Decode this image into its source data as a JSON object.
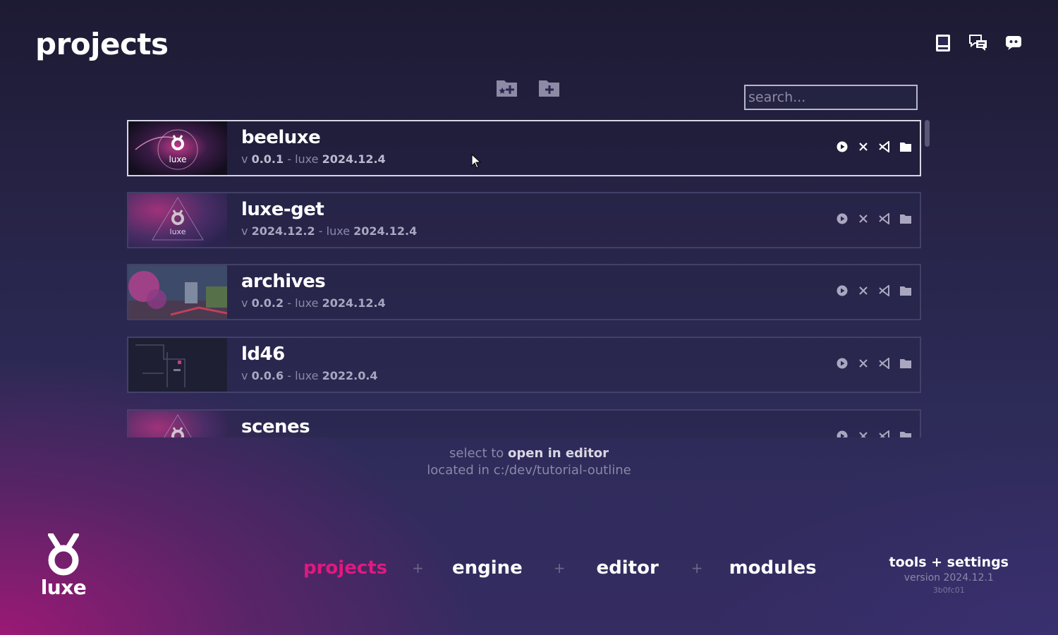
{
  "page": {
    "title": "projects"
  },
  "top_icons": [
    "book-icon",
    "chat-icon",
    "discord-icon"
  ],
  "tools": [
    "add-existing-folder-icon",
    "new-folder-icon"
  ],
  "search": {
    "placeholder": "search..."
  },
  "projects": [
    {
      "name": "beeluxe",
      "v_prefix": "v",
      "version": "0.0.1",
      "sep": "-",
      "engine_label": "luxe",
      "engine_version": "2024.12.4",
      "selected": true
    },
    {
      "name": "luxe-get",
      "v_prefix": "v",
      "version": "2024.12.2",
      "sep": "-",
      "engine_label": "luxe",
      "engine_version": "2024.12.4"
    },
    {
      "name": "archives",
      "v_prefix": "v",
      "version": "0.0.2",
      "sep": "-",
      "engine_label": "luxe",
      "engine_version": "2024.12.4"
    },
    {
      "name": "ld46",
      "v_prefix": "v",
      "version": "0.0.6",
      "sep": "-",
      "engine_label": "luxe",
      "engine_version": "2022.0.4"
    },
    {
      "name": "scenes"
    }
  ],
  "thumb_logo_text": "luxe",
  "row_actions": [
    "play-icon",
    "close-icon",
    "vscode-icon",
    "folder-icon"
  ],
  "hint": {
    "line1_prefix": "select to",
    "line1_action": "open in editor",
    "line2_prefix": "located in",
    "line2_path": "c:/dev/tutorial-outline"
  },
  "logo": {
    "text": "luxe"
  },
  "nav": {
    "items": [
      "projects",
      "engine",
      "editor",
      "modules"
    ],
    "separator": "+",
    "active_color": "#e0197f"
  },
  "footer": {
    "tools_label": "tools + settings",
    "version_label": "version 2024.12.1",
    "build": "3b0fc01"
  }
}
